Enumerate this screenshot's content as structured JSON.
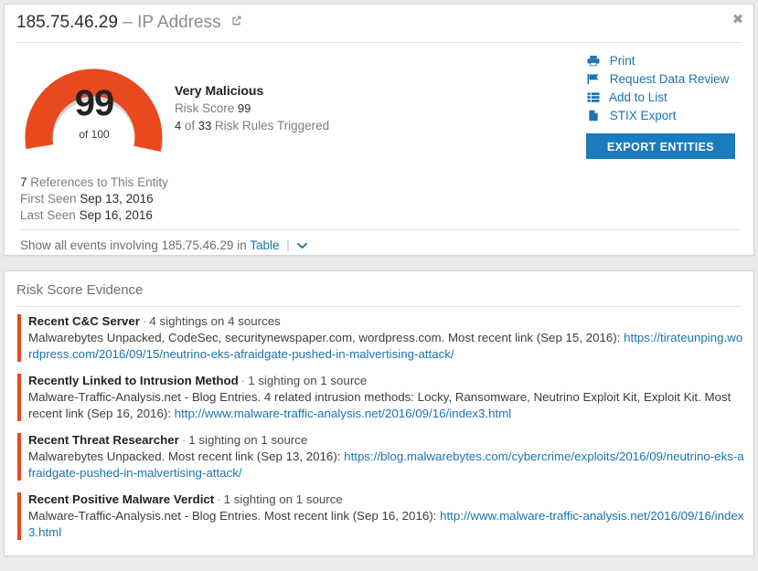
{
  "entity": {
    "ip": "185.75.46.29",
    "type_label": "– IP Address",
    "close_label": "✖",
    "external_link_icon": "external-link-icon"
  },
  "gauge": {
    "score": "99",
    "of_label": "of 100",
    "max": 100,
    "color": "#e8491f",
    "track_color": "#d7d7d7"
  },
  "risk_summary": {
    "verdict": "Very Malicious",
    "risk_score_label": "Risk Score",
    "risk_score_value": "99",
    "rules_triggered_prefix": "4",
    "rules_triggered_mid": "of",
    "rules_triggered_total": "33",
    "rules_triggered_suffix": "Risk Rules Triggered"
  },
  "actions": {
    "links": [
      {
        "label": "Print",
        "icon": "printer-icon"
      },
      {
        "label": "Request Data Review",
        "icon": "flag-icon"
      },
      {
        "label": "Add to List",
        "icon": "list-icon"
      },
      {
        "label": "STIX Export",
        "icon": "document-icon"
      }
    ],
    "export_button": "EXPORT ENTITIES",
    "link_color": "#1a74b0",
    "button_color": "#1a7bbd"
  },
  "references": {
    "count": "7",
    "count_suffix": "References to This Entity",
    "first_seen_label": "First Seen",
    "first_seen_value": "Sep 13, 2016",
    "last_seen_label": "Last Seen",
    "last_seen_value": "Sep 16, 2016"
  },
  "events_row": {
    "prefix": "Show all events involving",
    "entity": "185.75.46.29",
    "middle": "in",
    "link": "Table",
    "separator": "|",
    "chevron_icon": "chevron-down-icon"
  },
  "evidence": {
    "title": "Risk Score Evidence",
    "bar_color": "#e8491f",
    "items": [
      {
        "title": "Recent C&C Server",
        "dot": "·",
        "count": "4 sightings on 4 sources",
        "body": "Malwarebytes Unpacked, CodeSec, securitynewspaper.com, wordpress.com. Most recent link (Sep 15, 2016):",
        "link": "https://tirateunping.wordpress.com/2016/09/15/neutrino-eks-afraidgate-pushed-in-malvertising-attack/",
        "body_after": ""
      },
      {
        "title": "Recently Linked to Intrusion Method",
        "dot": "·",
        "count": "1 sighting on 1 source",
        "body": "Malware-Traffic-Analysis.net - Blog Entries. 4 related intrusion methods: Locky, Ransomware, Neutrino Exploit Kit, Exploit Kit. Most recent link (Sep 16, 2016):",
        "link": "http://www.malware-traffic-analysis.net/2016/09/16/index3.html",
        "body_after": ""
      },
      {
        "title": "Recent Threat Researcher",
        "dot": "·",
        "count": "1 sighting on 1 source",
        "body": "Malwarebytes Unpacked. Most recent link (Sep 13, 2016):",
        "link": "https://blog.malwarebytes.com/cybercrime/exploits/2016/09/neutrino-eks-afraidgate-pushed-in-malvertising-attack/",
        "body_after": ""
      },
      {
        "title": "Recent Positive Malware Verdict",
        "dot": "·",
        "count": "1 sighting on 1 source",
        "body": "Malware-Traffic-Analysis.net - Blog Entries. Most recent link (Sep 16, 2016):",
        "link": "http://www.malware-traffic-analysis.net/2016/09/16/index3.html",
        "body_after": ""
      }
    ]
  }
}
